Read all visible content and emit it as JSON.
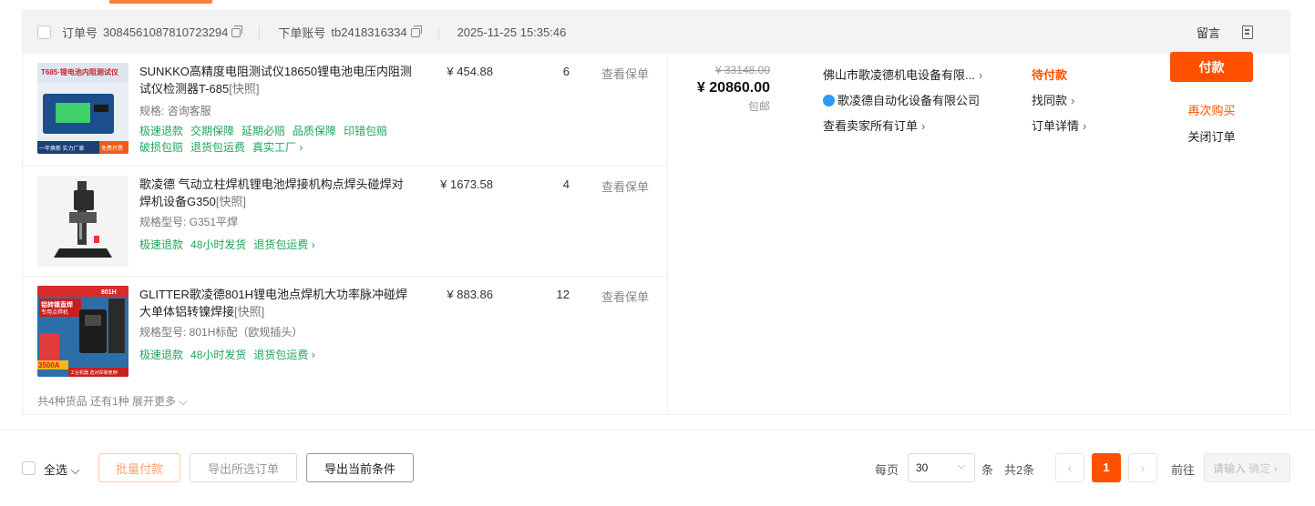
{
  "header": {
    "order_label": "订单号",
    "order_no": "3084561087810723294",
    "account_label": "下单账号",
    "account": "tb2418316334",
    "time": "2025-11-25 15:35:46",
    "message": "留言"
  },
  "items": [
    {
      "title": "SUNKKO高精度电阻测试仪18650锂电池电压内阻测试仪检测器T-685",
      "snapshot": "[快照]",
      "spec": "规格: 咨询客服",
      "tags_line1": [
        "极速退款",
        "交期保障",
        "延期必赔",
        "品质保障",
        "印错包赔"
      ],
      "tags_line2": [
        "破损包赔",
        "退货包运费",
        "真实工厂 ›"
      ],
      "price": "¥ 454.88",
      "qty": "6",
      "insurance": "查看保单",
      "thumb_text": [
        "T685·锂电池内阻测试仪",
        "一年换新 实力厂家",
        "免费开票"
      ]
    },
    {
      "title": "歌凌德 气动立柱焊机锂电池焊接机构点焊头碰焊对焊机设备G350",
      "snapshot": "[快照]",
      "spec": "规格型号: G351平焊",
      "tags_line1": [
        "极速退款",
        "48小时发货",
        "退货包运费 ›"
      ],
      "price": "¥ 1673.58",
      "qty": "4",
      "insurance": "查看保单"
    },
    {
      "title": "GLITTER歌凌德801H锂电池点焊机大功率脉冲碰焊大单体铝转镍焊接",
      "snapshot": "[快照]",
      "spec": "规格型号: 801H标配（欧规插头）",
      "tags_line1": [
        "极速退款",
        "48小时发货",
        "退货包运费 ›"
      ],
      "price": "¥ 883.86",
      "qty": "12",
      "insurance": "查看保单",
      "thumb_text": [
        "801H",
        "铝转镍直焊",
        "专用点焊机",
        "3500A",
        "工业机器 选对焊接使用!"
      ]
    }
  ],
  "more": "共4种货品  还有1种  展开更多",
  "amount": {
    "original": "¥ 33148.00",
    "total": "¥ 20860.00",
    "shipping": "包邮"
  },
  "seller": {
    "name": "佛山市歌凌德机电设备有限...",
    "shop": "歌凌德自动化设备有限公司",
    "all_orders": "查看卖家所有订单"
  },
  "status": {
    "state": "待付款",
    "similar": "找同款",
    "detail": "订单详情"
  },
  "actions": {
    "pay": "付款",
    "rebuy": "再次购买",
    "close": "关闭订单"
  },
  "footer": {
    "select_all": "全选",
    "batch_pay": "批量付款",
    "export_selected": "导出所选订单",
    "export_current": "导出当前条件",
    "per_page_label": "每页",
    "per_page": "30",
    "unit": "条",
    "total": "共2条",
    "current_page": "1",
    "goto_label": "前往",
    "goto_placeholder": "请输入",
    "goto_confirm": "确定"
  },
  "colors": {
    "accent": "#ff5000",
    "tag_green": "#1ea65a",
    "header_bg": "#f2f3f5"
  },
  "icons": [
    "copy-icon",
    "note-icon",
    "chevron-right-icon",
    "chevron-down-icon",
    "wangwang-icon"
  ]
}
